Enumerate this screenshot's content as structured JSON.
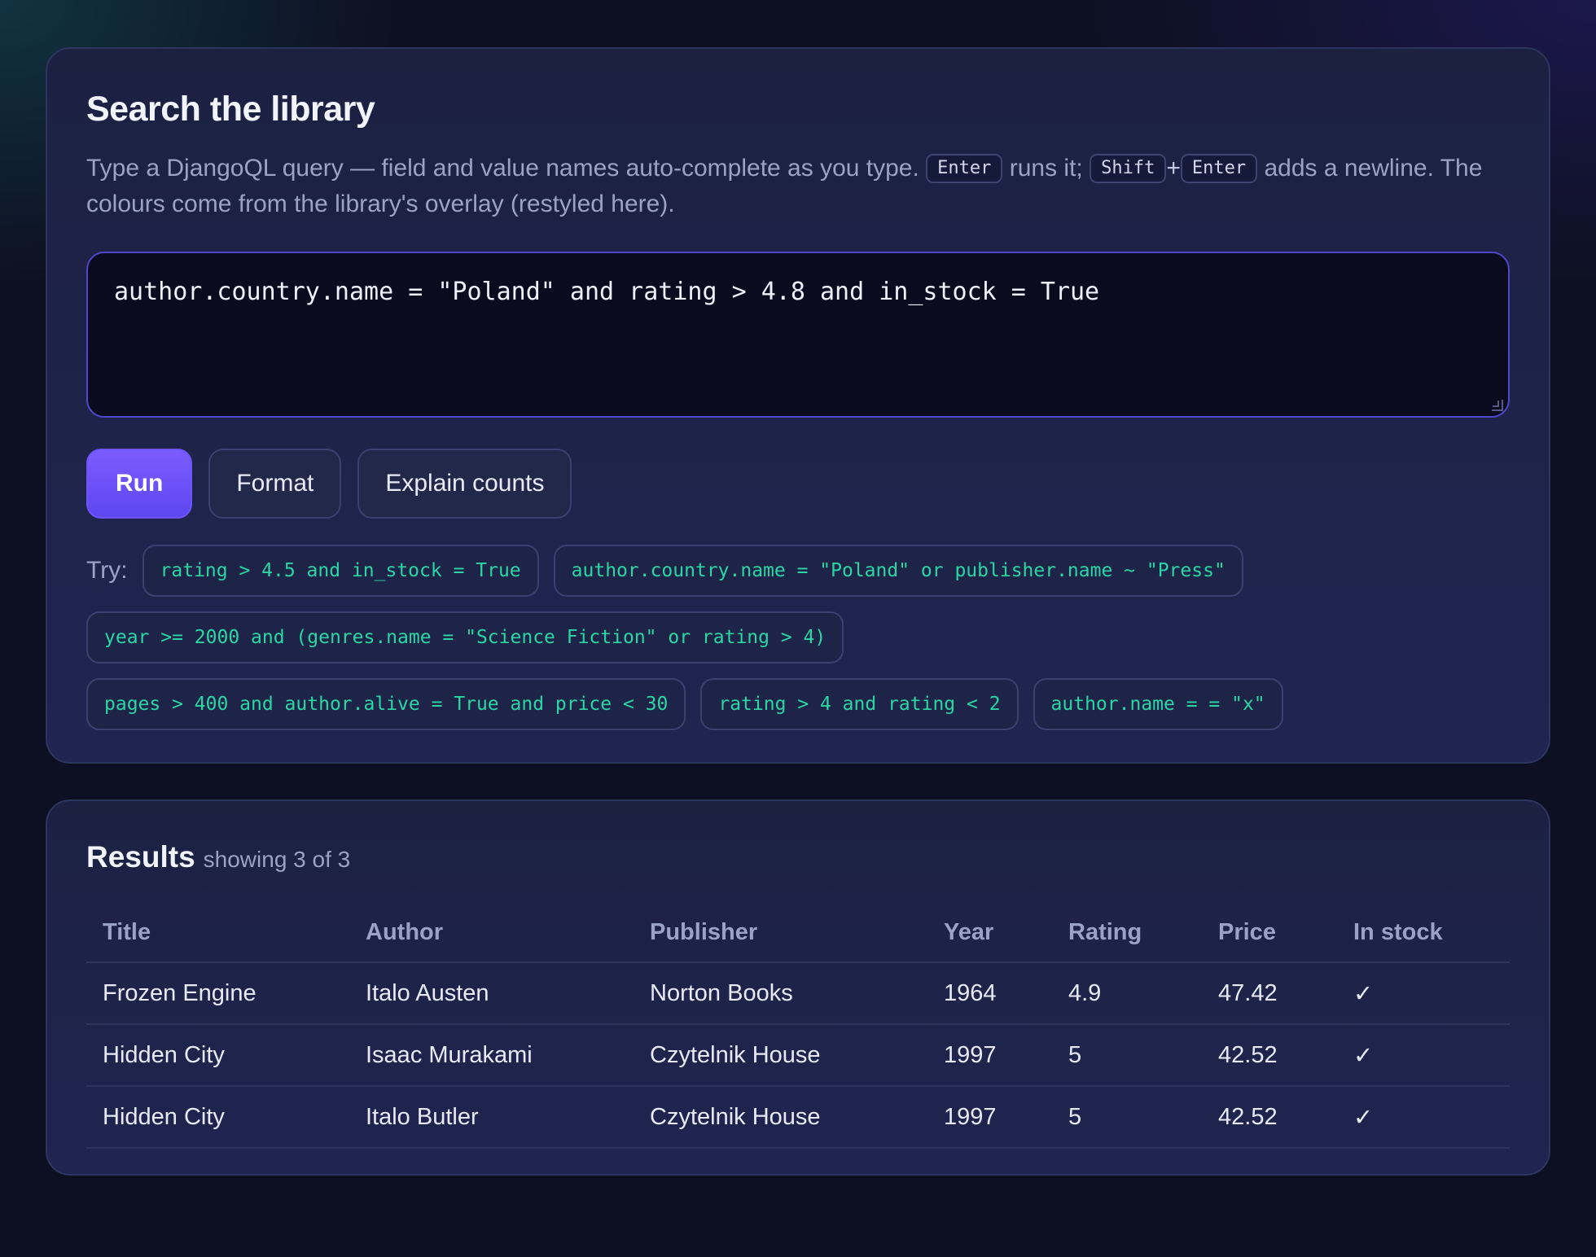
{
  "search": {
    "title": "Search the library",
    "desc_part1": "Type a DjangoQL query — field and value names auto-complete as you type.",
    "kbd_enter": "Enter",
    "desc_part2": "runs it;",
    "kbd_shift": "Shift",
    "plus": "+",
    "kbd_enter2": "Enter",
    "desc_part3": "adds a newline. The colours come from the library's overlay (restyled here).",
    "query": "author.country.name = \"Poland\" and rating > 4.8 and in_stock = True",
    "buttons": {
      "run": "Run",
      "format": "Format",
      "explain": "Explain counts"
    },
    "try_label": "Try:",
    "examples": [
      "rating > 4.5 and in_stock = True",
      "author.country.name = \"Poland\" or publisher.name ~ \"Press\"",
      "year >= 2000 and (genres.name = \"Science Fiction\" or rating > 4)",
      "pages > 400 and author.alive = True and price < 30",
      "rating > 4 and rating < 2",
      "author.name = = \"x\""
    ]
  },
  "results": {
    "title": "Results",
    "count": "showing 3 of 3",
    "columns": [
      "Title",
      "Author",
      "Publisher",
      "Year",
      "Rating",
      "Price",
      "In stock"
    ],
    "rows": [
      [
        "Frozen Engine",
        "Italo Austen",
        "Norton Books",
        "1964",
        "4.9",
        "47.42",
        "✓"
      ],
      [
        "Hidden City",
        "Isaac Murakami",
        "Czytelnik House",
        "1997",
        "5",
        "42.52",
        "✓"
      ],
      [
        "Hidden City",
        "Italo Butler",
        "Czytelnik House",
        "1997",
        "5",
        "42.52",
        "✓"
      ]
    ]
  }
}
